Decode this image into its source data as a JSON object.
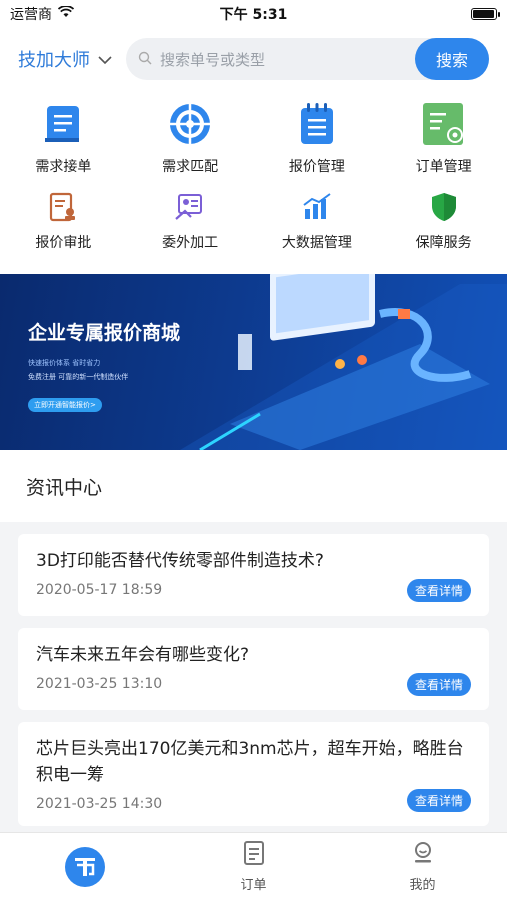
{
  "status": {
    "carrier": "运营商",
    "time": "下午 5:31",
    "battery_level": 0.9
  },
  "header": {
    "city": "技加大师",
    "search_placeholder": "搜索单号或类型",
    "search_button": "搜索"
  },
  "menu": [
    {
      "label": "需求接单",
      "icon": "document-icon",
      "color": "#2e86ec"
    },
    {
      "label": "需求匹配",
      "icon": "target-icon",
      "color": "#2e86ec"
    },
    {
      "label": "报价管理",
      "icon": "notepad-icon",
      "color": "#2e86ec"
    },
    {
      "label": "订单管理",
      "icon": "order-gear-icon",
      "color": "#4caf50"
    },
    {
      "label": "报价审批",
      "icon": "approval-icon",
      "color": "#c0663a"
    },
    {
      "label": "委外加工",
      "icon": "outsource-icon",
      "color": "#7b5fd6"
    },
    {
      "label": "大数据管理",
      "icon": "bar-chart-icon",
      "color": "#2e86ec"
    },
    {
      "label": "保障服务",
      "icon": "shield-icon",
      "color": "#28a745"
    }
  ],
  "banner": {
    "title": "企业专属报价商城",
    "line1": "快速报价体系  省时省力",
    "line2": "免费注册  可靠的新一代制造伙伴",
    "cta": "立即开通智能报价>"
  },
  "news_section": {
    "title": "资讯中心"
  },
  "news": [
    {
      "title": "3D打印能否替代传统零部件制造技术?",
      "date": "2020-05-17 18:59",
      "button": "查看详情"
    },
    {
      "title": "汽车未来五年会有哪些变化?",
      "date": "2021-03-25 13:10",
      "button": "查看详情"
    },
    {
      "title": "芯片巨头亮出170亿美元和3nm芯片，超车开始，略胜台积电一筹",
      "date": "2021-03-25 14:30",
      "button": "查看详情"
    }
  ],
  "tabs": [
    {
      "label": "",
      "icon": "home-icon"
    },
    {
      "label": "订单",
      "icon": "order-icon"
    },
    {
      "label": "我的",
      "icon": "profile-icon"
    }
  ],
  "colors": {
    "accent": "#2e86ec",
    "banner_dark": "#0a2a6e"
  }
}
